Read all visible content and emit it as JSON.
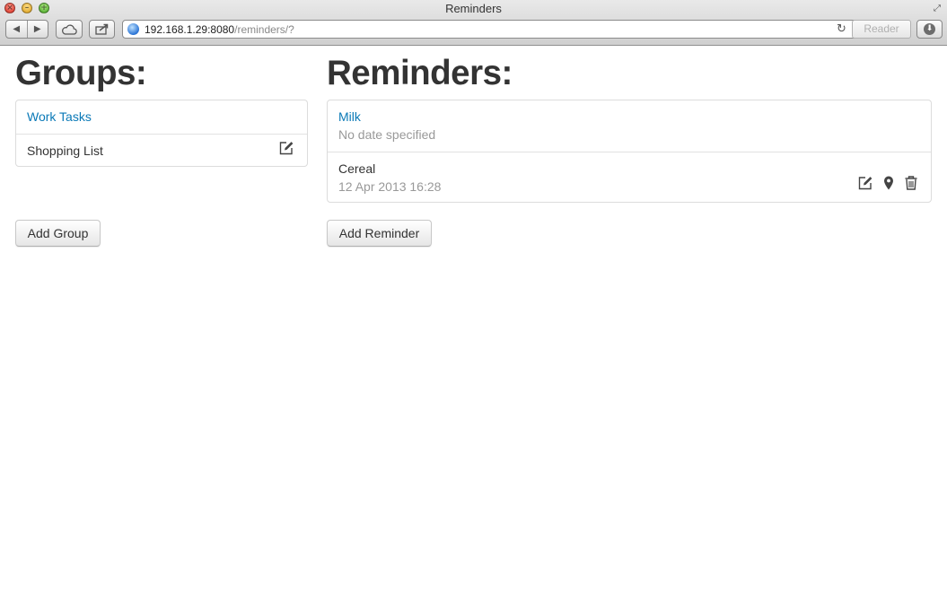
{
  "window": {
    "title": "Reminders"
  },
  "toolbar": {
    "url_host": "192.168.1.29:8080",
    "url_path": "/reminders/?",
    "reader_label": "Reader"
  },
  "groups": {
    "heading": "Groups:",
    "items": [
      {
        "label": "Work Tasks",
        "active": true
      },
      {
        "label": "Shopping List",
        "active": false,
        "action_icon": "edit-icon"
      }
    ],
    "add_label": "Add Group"
  },
  "reminders": {
    "heading": "Reminders:",
    "items": [
      {
        "title": "Milk",
        "date": "No date specified",
        "active": true
      },
      {
        "title": "Cereal",
        "date": "12 Apr 2013 16:28",
        "active": false,
        "action_icons": [
          "edit-icon",
          "map-marker-icon",
          "trash-icon"
        ]
      }
    ],
    "add_label": "Add Reminder"
  },
  "colors": {
    "link": "#0a79b7",
    "muted": "#999999",
    "text": "#333333"
  }
}
